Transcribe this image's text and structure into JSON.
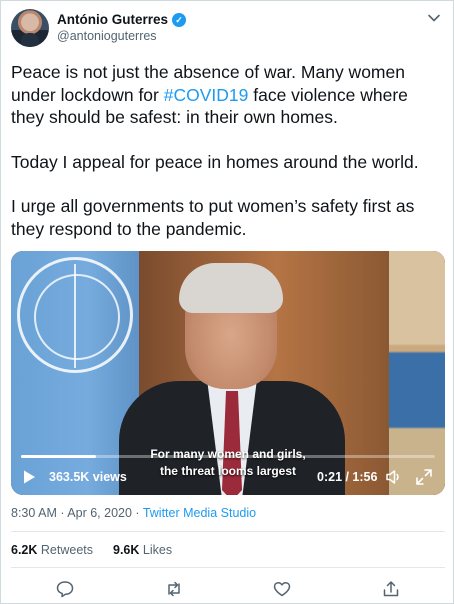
{
  "author": {
    "name": "António Guterres",
    "handle": "@antonioguterres",
    "verified": true
  },
  "tweet": {
    "line_1_before": "Peace is not just the absence of war. Many women under lockdown for ",
    "hashtag": "#COVID19",
    "line_1_after": " face violence where they should be safest: in their own homes.",
    "paragraph_2": "Today I appeal for peace in homes around the world.",
    "paragraph_3": "I urge all governments to put women’s safety first as they respond to the pandemic."
  },
  "video": {
    "caption_line_1": "For many women and girls,",
    "caption_line_2": "the threat looms largest",
    "views": "363.5K views",
    "time": "0:21 / 1:56",
    "progress": 0.18
  },
  "meta": {
    "time": "8:30 AM",
    "separator": " · ",
    "date": "Apr 6, 2020",
    "separator_2": " · ",
    "source": "Twitter Media Studio"
  },
  "stats": {
    "retweets_count": "6.2K",
    "retweets_label": "Retweets",
    "likes_count": "9.6K",
    "likes_label": "Likes"
  },
  "colors": {
    "accent": "#1d9bf0",
    "text": "#0f1419",
    "muted": "#536471"
  },
  "icons": [
    "verified-icon",
    "chevron-down-icon",
    "play-icon",
    "volume-icon",
    "fullscreen-icon",
    "reply-icon",
    "retweet-icon",
    "like-icon",
    "share-icon"
  ]
}
